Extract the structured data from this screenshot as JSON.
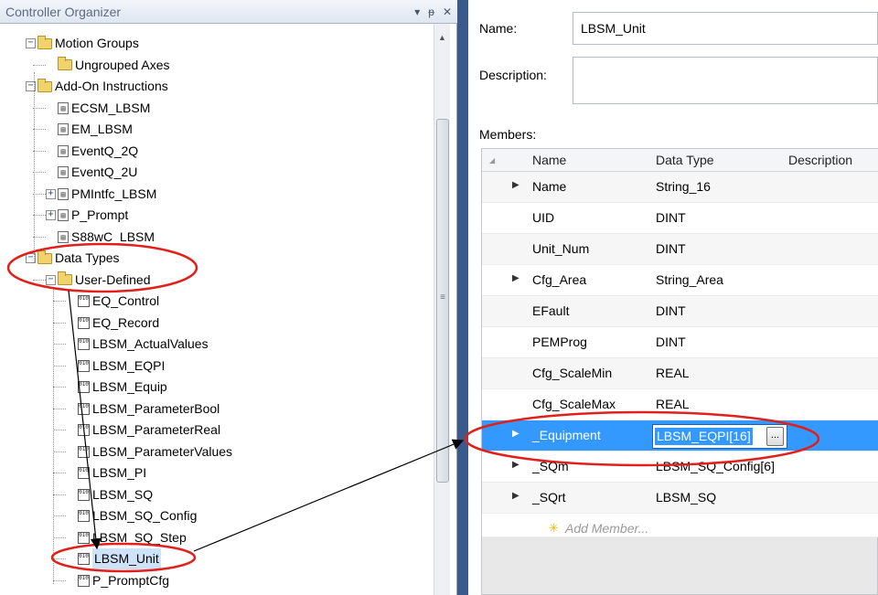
{
  "organizer": {
    "title": "Controller Organizer",
    "header_controls": [
      "▾",
      "ᵽ",
      "✕"
    ]
  },
  "tree": [
    {
      "label": "Motion Groups",
      "icon": "folder-icon",
      "expander": "−"
    },
    {
      "label": "Ungrouped Axes",
      "icon": "folder-icon",
      "expander": ""
    },
    {
      "label": "Add-On Instructions",
      "icon": "folder-icon",
      "expander": "−"
    },
    {
      "label": "ECSM_LBSM",
      "icon": "aoi-icon",
      "expander": ""
    },
    {
      "label": "EM_LBSM",
      "icon": "aoi-icon",
      "expander": ""
    },
    {
      "label": "EventQ_2Q",
      "icon": "aoi-icon",
      "expander": ""
    },
    {
      "label": "EventQ_2U",
      "icon": "aoi-icon",
      "expander": ""
    },
    {
      "label": "PMIntfc_LBSM",
      "icon": "aoi-icon",
      "expander": "+"
    },
    {
      "label": "P_Prompt",
      "icon": "aoi-icon",
      "expander": "+"
    },
    {
      "label": "S88wC_LBSM",
      "icon": "aoi-icon",
      "expander": ""
    },
    {
      "label": "Data Types",
      "icon": "folder-icon",
      "expander": "−"
    },
    {
      "label": "User-Defined",
      "icon": "folder-icon",
      "expander": "−"
    },
    {
      "label": "EQ_Control",
      "icon": "udt-icon",
      "expander": ""
    },
    {
      "label": "EQ_Record",
      "icon": "udt-icon",
      "expander": ""
    },
    {
      "label": "LBSM_ActualValues",
      "icon": "udt-icon",
      "expander": ""
    },
    {
      "label": "LBSM_EQPI",
      "icon": "udt-icon",
      "expander": ""
    },
    {
      "label": "LBSM_Equip",
      "icon": "udt-icon",
      "expander": ""
    },
    {
      "label": "LBSM_ParameterBool",
      "icon": "udt-icon",
      "expander": ""
    },
    {
      "label": "LBSM_ParameterReal",
      "icon": "udt-icon",
      "expander": ""
    },
    {
      "label": "LBSM_ParameterValues",
      "icon": "udt-icon",
      "expander": ""
    },
    {
      "label": "LBSM_PI",
      "icon": "udt-icon",
      "expander": ""
    },
    {
      "label": "LBSM_SQ",
      "icon": "udt-icon",
      "expander": ""
    },
    {
      "label": "LBSM_SQ_Config",
      "icon": "udt-icon",
      "expander": ""
    },
    {
      "label": "LBSM_SQ_Step",
      "icon": "udt-icon",
      "expander": ""
    },
    {
      "label": "LBSM_Unit",
      "icon": "udt-icon",
      "expander": "",
      "selected": true
    },
    {
      "label": "P_PromptCfg",
      "icon": "udt-icon",
      "expander": ""
    }
  ],
  "editor": {
    "name_label": "Name:",
    "name_value": "LBSM_Unit",
    "description_label": "Description:",
    "description_value": "",
    "members_label": "Members:",
    "columns": [
      "Name",
      "Data Type",
      "Description"
    ],
    "members": [
      {
        "name": "Name",
        "type": "String_16",
        "expandable": true
      },
      {
        "name": "UID",
        "type": "DINT",
        "expandable": false
      },
      {
        "name": "Unit_Num",
        "type": "DINT",
        "expandable": false
      },
      {
        "name": "Cfg_Area",
        "type": "String_Area",
        "expandable": true
      },
      {
        "name": "EFault",
        "type": "DINT",
        "expandable": false
      },
      {
        "name": "PEMProg",
        "type": "DINT",
        "expandable": false
      },
      {
        "name": "Cfg_ScaleMin",
        "type": "REAL",
        "expandable": false
      },
      {
        "name": "Cfg_ScaleMax",
        "type": "REAL",
        "expandable": false
      },
      {
        "name": "_Equipment",
        "type": "LBSM_EQPI[16]",
        "expandable": true,
        "selected": true
      },
      {
        "name": "_SQm",
        "type": "LBSM_SQ_Config[6]",
        "expandable": true
      },
      {
        "name": "_SQrt",
        "type": "LBSM_SQ",
        "expandable": true
      }
    ],
    "add_member": "Add Member...",
    "browse_button": "..."
  },
  "colors": {
    "selection": "#3399ff",
    "annotation": "#e0201a",
    "divider": "#3a5a8c"
  }
}
